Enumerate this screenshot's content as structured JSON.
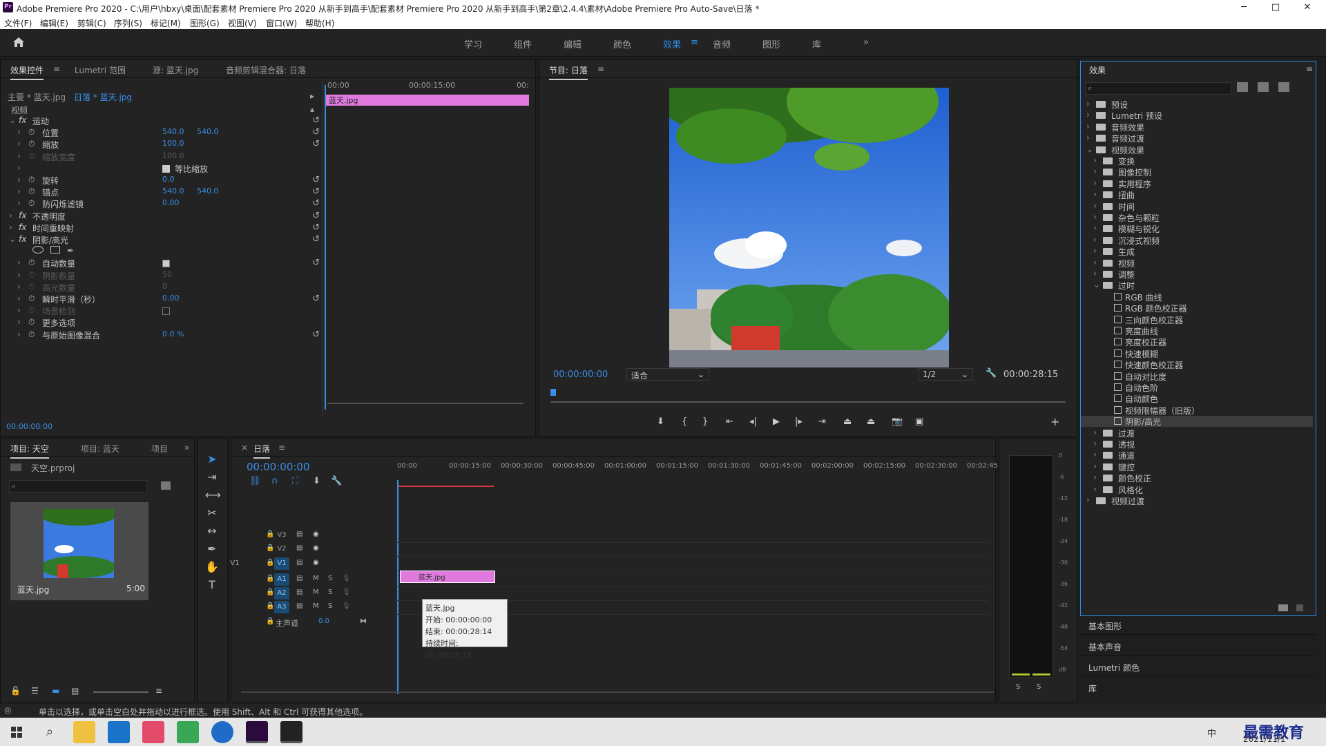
{
  "window": {
    "title": "Adobe Premiere Pro 2020 - C:\\用户\\hbxy\\桌面\\配套素材 Premiere Pro 2020 从新手到高手\\配套素材 Premiere Pro 2020 从新手到高手\\第2章\\2.4.4\\素材\\Adobe Premiere Pro Auto-Save\\日落 *",
    "app_icon": "Pr",
    "minimize": "─",
    "maximize": "□",
    "close": "✕"
  },
  "menu": [
    "文件(F)",
    "编辑(E)",
    "剪辑(C)",
    "序列(S)",
    "标记(M)",
    "图形(G)",
    "视图(V)",
    "窗口(W)",
    "帮助(H)"
  ],
  "workspaces": {
    "items": [
      "学习",
      "组件",
      "编辑",
      "颜色",
      "效果",
      "音频",
      "图形",
      "库"
    ],
    "active": "效果",
    "more": "»",
    "menu": "≡"
  },
  "effect_controls": {
    "tabs": [
      "效果控件",
      "Lumetri 范围",
      "源: 蓝天.jpg",
      "音频剪辑混合器: 日落"
    ],
    "tab_menu": "≡",
    "master": "主要 * 蓝天.jpg",
    "clip": "日落 * 蓝天.jpg",
    "section": "视频",
    "mini_tc": [
      "00:00",
      "00:00:15:00",
      "00:"
    ],
    "clip_label": "蓝天.jpg",
    "rows": [
      {
        "label": "运动",
        "fx": true
      },
      {
        "label": "位置",
        "v1": "540.0",
        "v2": "540.0"
      },
      {
        "label": "缩放",
        "v1": "100.0"
      },
      {
        "label": "缩放宽度",
        "v1": "100.0",
        "dim": true
      },
      {
        "label": "等比缩放",
        "check": true
      },
      {
        "label": "旋转",
        "v1": "0.0"
      },
      {
        "label": "锚点",
        "v1": "540.0",
        "v2": "540.0"
      },
      {
        "label": "防闪烁滤镜",
        "v1": "0.00"
      },
      {
        "label": "不透明度",
        "fx": true
      },
      {
        "label": "时间重映射",
        "fx": true
      },
      {
        "label": "阴影/高光",
        "fx": true
      },
      {
        "label": "自动数量",
        "check": true
      },
      {
        "label": "阴影数量",
        "v1": "50",
        "dim": true
      },
      {
        "label": "高光数量",
        "v1": "0",
        "dim": true
      },
      {
        "label": "瞬时平滑（秒）",
        "v1": "0.00"
      },
      {
        "label": "场景检测",
        "dim": true
      },
      {
        "label": "更多选项"
      },
      {
        "label": "与原始图像混合",
        "v1": "0.0 %"
      }
    ],
    "timecode": "00:00:00:00"
  },
  "program": {
    "title": "节目: 日落",
    "menu": "≡",
    "timecode": "00:00:00:00",
    "fit": "适合",
    "quality": "1/2",
    "duration": "00:00:28:15"
  },
  "project": {
    "tabs": [
      "项目: 天空",
      "项目: 蓝天",
      "项目"
    ],
    "more": "»",
    "file": "天空.prproj",
    "clip_name": "蓝天.jpg",
    "clip_dur": "5:00"
  },
  "timeline": {
    "title": "日落",
    "menu": "≡",
    "close": "×",
    "timecode": "00:00:00:00",
    "ruler": [
      "00:00",
      "00:00:15:00",
      "00:00:30:00",
      "00:00:45:00",
      "00:01:00:00",
      "00:01:15:00",
      "00:01:30:00",
      "00:01:45:00",
      "00:02:00:00",
      "00:02:15:00",
      "00:02:30:00",
      "00:02:45:"
    ],
    "tracks": [
      "V3",
      "V2",
      "V1",
      "A1",
      "A2",
      "A3"
    ],
    "source_patch": "V1",
    "master": "主声道",
    "master_val": "0.0",
    "clip": "蓝天.jpg",
    "tooltip": [
      "蓝天.jpg",
      "开始: 00:00:00:00",
      "结束: 00:00:28:14",
      "持续时间: 00:00:28:15"
    ]
  },
  "meter": {
    "labels": [
      "0",
      "-6",
      "-12",
      "-18",
      "-24",
      "-30",
      "-36",
      "-42",
      "-48",
      "-54",
      "dB"
    ],
    "solo": [
      "S",
      "S"
    ]
  },
  "effects": {
    "title": "效果",
    "menu": "≡",
    "tree": [
      {
        "label": "预设",
        "lvl": 0,
        "type": "folder"
      },
      {
        "label": "Lumetri 预设",
        "lvl": 0,
        "type": "folder"
      },
      {
        "label": "音频效果",
        "lvl": 0,
        "type": "folder"
      },
      {
        "label": "音频过渡",
        "lvl": 0,
        "type": "folder"
      },
      {
        "label": "视频效果",
        "lvl": 0,
        "type": "folder",
        "open": true
      },
      {
        "label": "变换",
        "lvl": 1,
        "type": "folder"
      },
      {
        "label": "图像控制",
        "lvl": 1,
        "type": "folder"
      },
      {
        "label": "实用程序",
        "lvl": 1,
        "type": "folder"
      },
      {
        "label": "扭曲",
        "lvl": 1,
        "type": "folder"
      },
      {
        "label": "时间",
        "lvl": 1,
        "type": "folder"
      },
      {
        "label": "杂色与颗粒",
        "lvl": 1,
        "type": "folder"
      },
      {
        "label": "模糊与锐化",
        "lvl": 1,
        "type": "folder"
      },
      {
        "label": "沉浸式视频",
        "lvl": 1,
        "type": "folder"
      },
      {
        "label": "生成",
        "lvl": 1,
        "type": "folder"
      },
      {
        "label": "视频",
        "lvl": 1,
        "type": "folder"
      },
      {
        "label": "调整",
        "lvl": 1,
        "type": "folder"
      },
      {
        "label": "过时",
        "lvl": 1,
        "type": "folder",
        "open": true
      },
      {
        "label": "RGB 曲线",
        "lvl": 2,
        "type": "fx"
      },
      {
        "label": "RGB 颜色校正器",
        "lvl": 2,
        "type": "fx"
      },
      {
        "label": "三向颜色校正器",
        "lvl": 2,
        "type": "fx"
      },
      {
        "label": "亮度曲线",
        "lvl": 2,
        "type": "fx"
      },
      {
        "label": "亮度校正器",
        "lvl": 2,
        "type": "fx"
      },
      {
        "label": "快速模糊",
        "lvl": 2,
        "type": "fx"
      },
      {
        "label": "快速颜色校正器",
        "lvl": 2,
        "type": "fx"
      },
      {
        "label": "自动对比度",
        "lvl": 2,
        "type": "fx"
      },
      {
        "label": "自动色阶",
        "lvl": 2,
        "type": "fx"
      },
      {
        "label": "自动颜色",
        "lvl": 2,
        "type": "fx"
      },
      {
        "label": "视频限幅器（旧版）",
        "lvl": 2,
        "type": "fx"
      },
      {
        "label": "阴影/高光",
        "lvl": 2,
        "type": "fx",
        "selected": true
      },
      {
        "label": "过渡",
        "lvl": 1,
        "type": "folder"
      },
      {
        "label": "透视",
        "lvl": 1,
        "type": "folder"
      },
      {
        "label": "通道",
        "lvl": 1,
        "type": "folder"
      },
      {
        "label": "键控",
        "lvl": 1,
        "type": "folder"
      },
      {
        "label": "颜色校正",
        "lvl": 1,
        "type": "folder"
      },
      {
        "label": "风格化",
        "lvl": 1,
        "type": "folder"
      },
      {
        "label": "视频过渡",
        "lvl": 0,
        "type": "folder"
      }
    ],
    "bottom": [
      "基本图形",
      "基本声音",
      "Lumetri 颜色",
      "库"
    ]
  },
  "status": "单击以选择，或单击空白处并拖动以进行框选。使用 Shift、Alt 和 Ctrl 可获得其他选项。",
  "taskbar": {
    "clock_date": "2021/11/1",
    "watermark": "最需教育",
    "ime": "中"
  },
  "colors": {
    "accent": "#2d8ceb",
    "clip_pink": "#e07adf",
    "playhead": "#3a8ee6"
  }
}
